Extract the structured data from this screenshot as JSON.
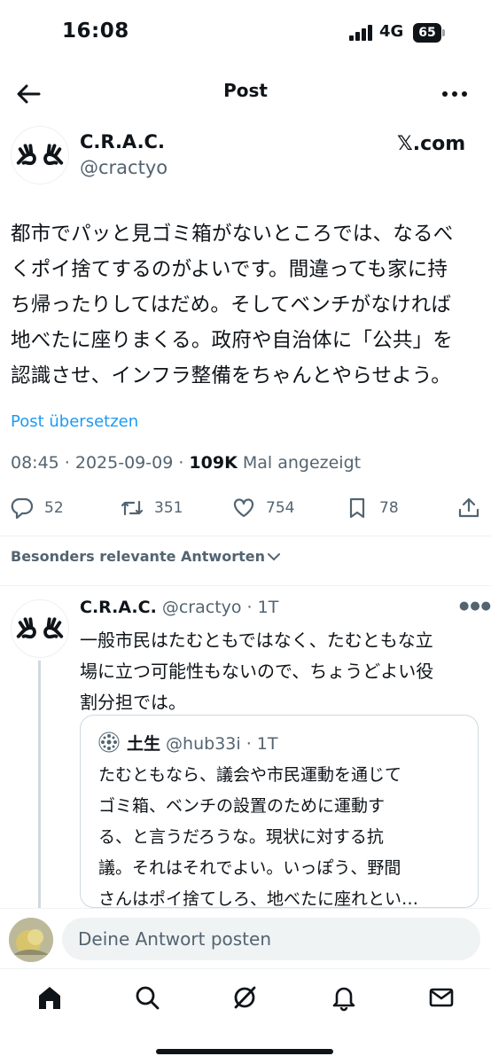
{
  "status_bar": {
    "time": "16:08",
    "network": "4G",
    "battery": "65"
  },
  "header": {
    "title": "Post"
  },
  "author": {
    "name": "C.R.A.C.",
    "handle": "@cractyo",
    "source": "𝕏.com"
  },
  "tweet": {
    "lines": [
      "都市でパッと見ゴミ箱がないところでは、なるべ",
      "くポイ捨てするのがよいです。間違っても家に持",
      "ち帰ったりしてはだめ。そしてベンチがなければ",
      "地べたに座りまくる。政府や自治体に「公共」を",
      "認識させ、インフラ整備をちゃんとやらせよう。"
    ],
    "translate_label": "Post übersetzen",
    "timestamp": "08:45 · 2025-09-09 · ",
    "views": "109K",
    "views_suffix": " Mal angezeigt"
  },
  "actions": {
    "replies": "52",
    "reposts": "351",
    "likes": "754",
    "bookmarks": "78"
  },
  "replies_sort": {
    "label": "Besonders relevante Antworten"
  },
  "reply": {
    "name": "C.R.A.C.",
    "handle": " @cractyo · 1T",
    "lines": [
      "一般市民はたむともではなく、たむともな立",
      "場に立つ可能性もないので、ちょうどよい役",
      "割分担では。"
    ],
    "quote": {
      "name": "土生",
      "handle": " @hub33i · 1T",
      "lines": [
        "たむともなら、議会や市民運動を通じて",
        "ゴミ箱、ベンチの設置のために運動す",
        "る、と言うだろうな。現状に対する抗",
        "議。それはそれでよい。いっぽう、野間",
        "さんはポイ捨てしろ、地べたに座れとい…"
      ]
    }
  },
  "compose": {
    "placeholder": "Deine Antwort posten"
  },
  "icons": {
    "back": "arrow-left-icon",
    "more": "more-dots-icon",
    "reply": "speech-bubble-icon",
    "repost": "repost-arrows-icon",
    "like": "heart-icon",
    "bookmark": "bookmark-icon",
    "share": "share-icon",
    "tabs": [
      "home-icon",
      "search-icon",
      "grok-icon",
      "notifications-bell-icon",
      "messages-envelope-icon"
    ]
  },
  "colors": {
    "accent": "#1d9bf0",
    "text": "#0f1419",
    "muted": "#536471",
    "border": "#cfd9de"
  }
}
